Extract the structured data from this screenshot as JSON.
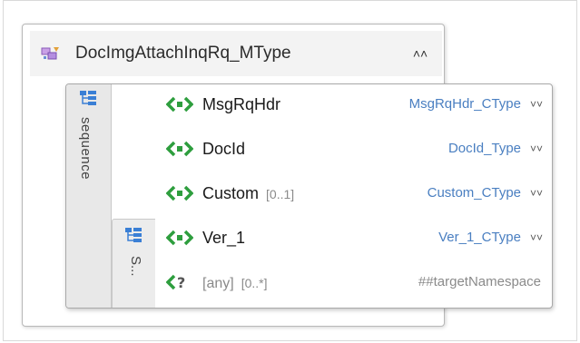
{
  "complex_type": {
    "name": "DocImgAttachInqRq_MType",
    "collapse_glyph": "˄˄",
    "icon": "complex-type-icon"
  },
  "sequence": {
    "label": "sequence",
    "icon": "sequence-icon",
    "inner_label": "S..."
  },
  "elements": [
    {
      "name": "MsgRqHdr",
      "occurs": "",
      "type": "MsgRqHdr_CType",
      "expand": "˅˅"
    },
    {
      "name": "DocId",
      "occurs": "",
      "type": "DocId_Type",
      "expand": "˅˅"
    },
    {
      "name": "Custom",
      "occurs": "[0..1]",
      "type": "Custom_CType",
      "expand": "˅˅"
    },
    {
      "name": "Ver_1",
      "occurs": "",
      "type": "Ver_1_CType",
      "expand": "˅˅"
    }
  ],
  "any": {
    "name": "[any]",
    "occurs": "[0..*]",
    "namespace": "##targetNamespace"
  },
  "colors": {
    "element_icon": "#2e9e3e",
    "type_link": "#4a7fc1",
    "sequence_icon": "#3a7fd5"
  }
}
